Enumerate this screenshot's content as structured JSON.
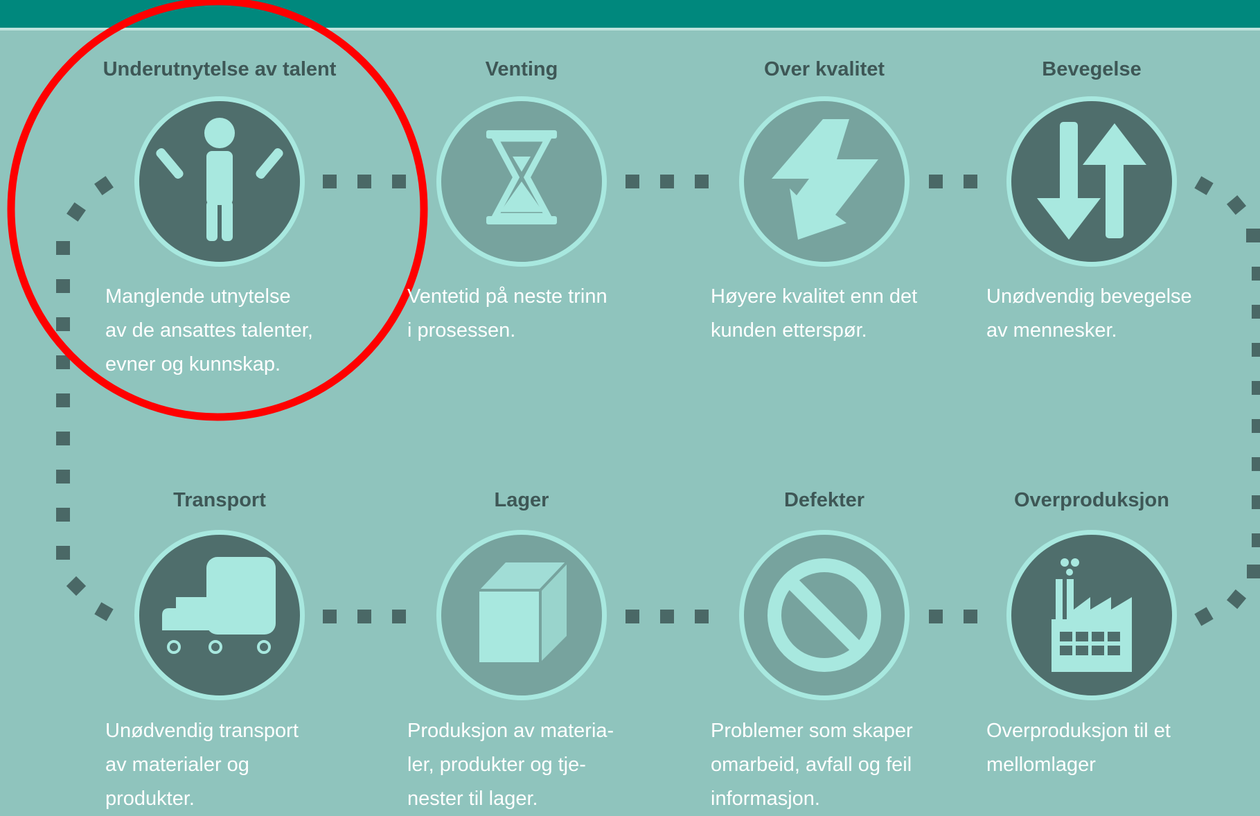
{
  "colors": {
    "background": "#8fc4bd",
    "top_bar": "#00887d",
    "dark_circle": "#4f6e6c",
    "mid_circle": "#77a39e",
    "icon_fill": "#a8e8df",
    "connector": "#4a6866",
    "highlight_ring": "#ff0000",
    "title_text": "#3e5756",
    "description_text": "#ffffff"
  },
  "wastes": [
    {
      "title": "Underutnytelse av talent",
      "icon": "person-arms-raised-icon",
      "tone": "dark",
      "description": "Manglende utnytelse\nav de ansattes talenter,\nevner og kunnskap.",
      "highlighted": true
    },
    {
      "title": "Venting",
      "icon": "hourglass-icon",
      "tone": "mid",
      "description": "Ventetid på neste trinn\ni prosessen.",
      "highlighted": false
    },
    {
      "title": "Over kvalitet",
      "icon": "lightning-arrow-icon",
      "tone": "mid",
      "description": "Høyere kvalitet enn det\nkunden etterspør.",
      "highlighted": false
    },
    {
      "title": "Bevegelse",
      "icon": "up-down-arrows-icon",
      "tone": "dark",
      "description": "Unødvendig bevegelse\nav mennesker.",
      "highlighted": false
    },
    {
      "title": "Transport",
      "icon": "truck-icon",
      "tone": "dark",
      "description": "Unødvendig transport\nav materialer og\nprodukter.",
      "highlighted": false
    },
    {
      "title": "Lager",
      "icon": "box-icon",
      "tone": "mid",
      "description": "Produksjon av materia-\nler, produkter og tje-\nnester til lager.",
      "highlighted": false
    },
    {
      "title": "Defekter",
      "icon": "prohibited-icon",
      "tone": "mid",
      "description": "Problemer som skaper\nomarbeid, avfall og feil\ninformasjon.",
      "highlighted": false
    },
    {
      "title": "Overproduksjon",
      "icon": "factory-icon",
      "tone": "dark",
      "description": "Overproduksjon til et\nmellomlager",
      "highlighted": false
    }
  ]
}
